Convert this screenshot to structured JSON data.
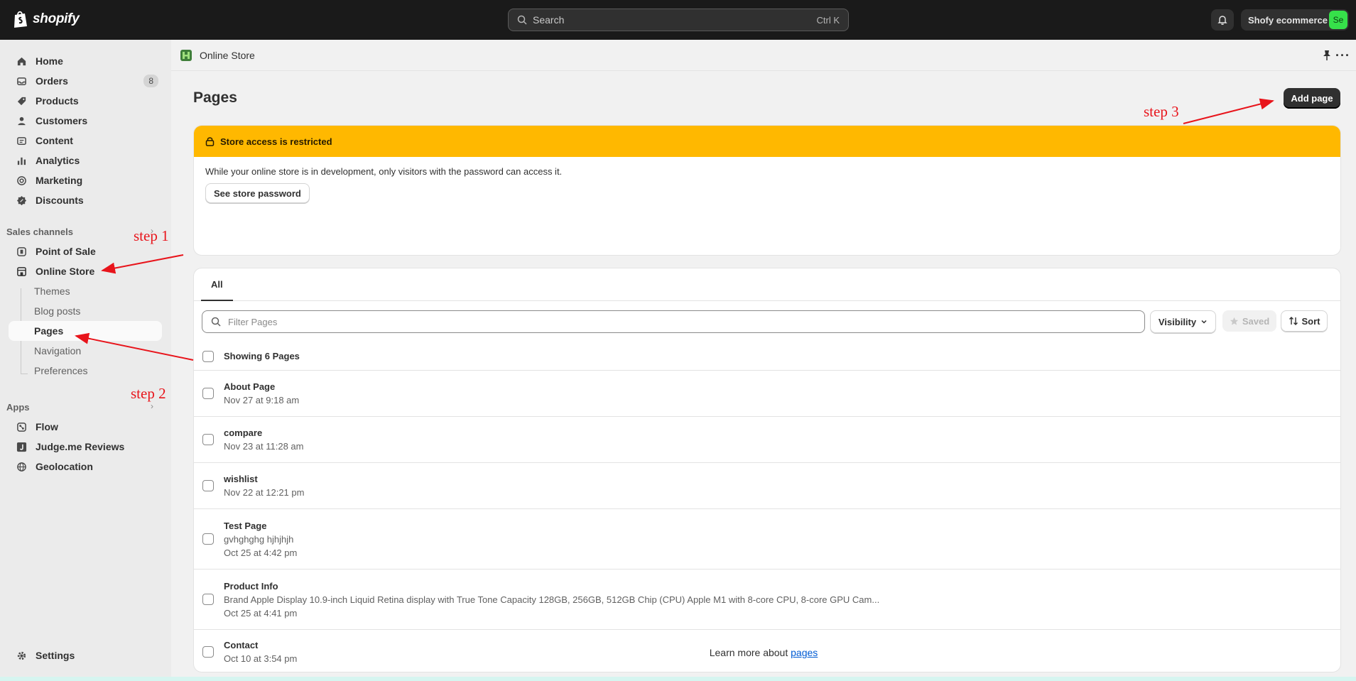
{
  "topbar": {
    "logo_text": "shopify",
    "search_placeholder": "Search",
    "search_shortcut": "Ctrl K",
    "store_name": "Shofy ecommerce",
    "store_initials": "Se"
  },
  "sidebar": {
    "items": [
      {
        "label": "Home",
        "icon": "home-icon"
      },
      {
        "label": "Orders",
        "icon": "inbox-icon",
        "count": "8"
      },
      {
        "label": "Products",
        "icon": "tag-icon"
      },
      {
        "label": "Customers",
        "icon": "person-icon"
      },
      {
        "label": "Content",
        "icon": "content-icon"
      },
      {
        "label": "Analytics",
        "icon": "bar-chart-icon"
      },
      {
        "label": "Marketing",
        "icon": "target-icon"
      },
      {
        "label": "Discounts",
        "icon": "discount-icon"
      }
    ],
    "sales_channels_label": "Sales channels",
    "channels": [
      {
        "label": "Point of Sale",
        "icon": "pos-icon"
      },
      {
        "label": "Online Store",
        "icon": "store-icon"
      }
    ],
    "online_store_subitems": [
      {
        "label": "Themes"
      },
      {
        "label": "Blog posts"
      },
      {
        "label": "Pages",
        "active": true
      },
      {
        "label": "Navigation"
      },
      {
        "label": "Preferences"
      }
    ],
    "apps_label": "Apps",
    "apps": [
      {
        "label": "Flow",
        "icon": "flow-icon"
      },
      {
        "label": "Judge.me Reviews",
        "icon": "judgeme-icon"
      },
      {
        "label": "Geolocation",
        "icon": "globe-icon"
      }
    ],
    "settings_label": "Settings"
  },
  "subheader": {
    "title": "Online Store"
  },
  "page": {
    "title": "Pages",
    "add_button": "Add page"
  },
  "banner": {
    "title": "Store access is restricted",
    "message": "While your online store is in development, only visitors with the password can access it.",
    "button": "See store password",
    "color": "#ffb800"
  },
  "list": {
    "tab_all": "All",
    "filter_placeholder": "Filter Pages",
    "visibility_label": "Visibility",
    "saved_label": "Saved",
    "sort_label": "Sort",
    "showing_label": "Showing 6 Pages",
    "rows": [
      {
        "title": "About Page",
        "lines": [
          "Nov 27 at 9:18 am"
        ]
      },
      {
        "title": "compare",
        "lines": [
          "Nov 23 at 11:28 am"
        ]
      },
      {
        "title": "wishlist",
        "lines": [
          "Nov 22 at 12:21 pm"
        ]
      },
      {
        "title": "Test Page",
        "lines": [
          "gvhghghg hjhjhjh",
          "Oct 25 at 4:42 pm"
        ]
      },
      {
        "title": "Product Info",
        "lines": [
          "Brand Apple Display 10.9-inch Liquid Retina display with True Tone Capacity 128GB, 256GB, 512GB Chip (CPU) Apple M1 with 8-core CPU, 8-core GPU Cam...",
          "Oct 25 at 4:41 pm"
        ]
      },
      {
        "title": "Contact",
        "lines": [
          "Oct 10 at 3:54 pm"
        ]
      }
    ]
  },
  "footer": {
    "learn_prefix": "Learn more about ",
    "learn_link": "pages"
  },
  "annotations": {
    "step1": "step 1",
    "step2": "step 2",
    "step3": "step 3",
    "color": "#e8141b"
  }
}
